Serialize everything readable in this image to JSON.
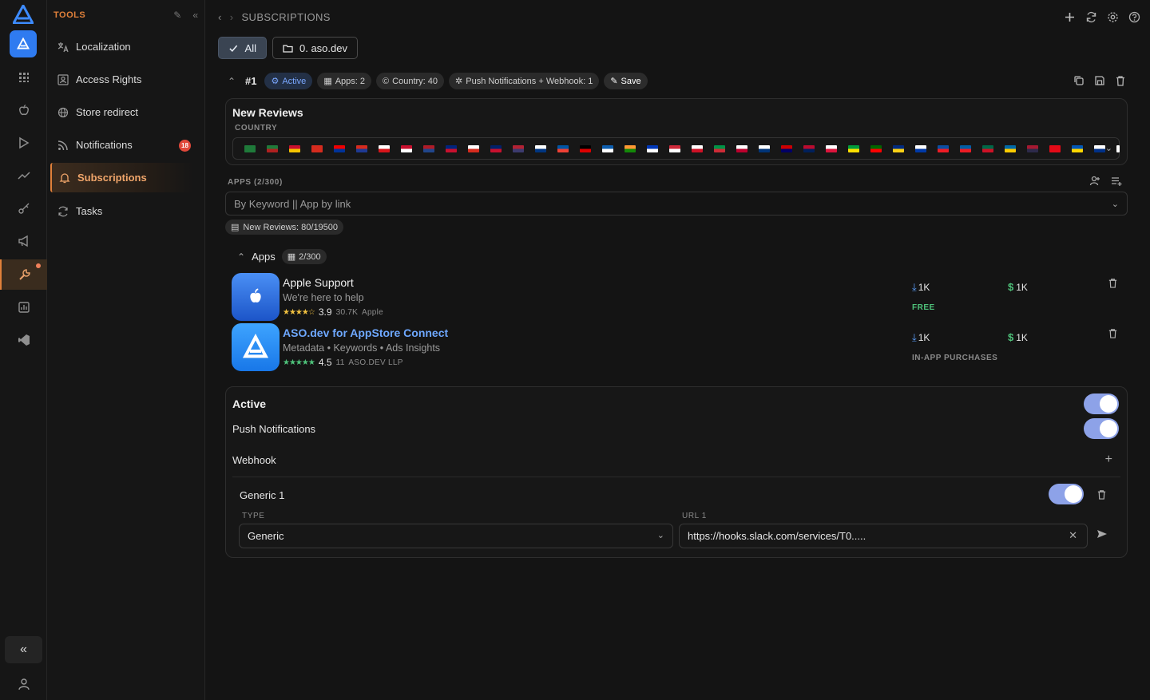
{
  "sidebar": {
    "header": "TOOLS",
    "items": [
      {
        "label": "Localization",
        "icon": "translate-icon"
      },
      {
        "label": "Access Rights",
        "icon": "access-icon"
      },
      {
        "label": "Store redirect",
        "icon": "globe-icon"
      },
      {
        "label": "Notifications",
        "icon": "rss-icon",
        "badge": "18"
      },
      {
        "label": "Subscriptions",
        "icon": "bell-icon",
        "selected": true
      },
      {
        "label": "Tasks",
        "icon": "tasks-icon"
      }
    ]
  },
  "header": {
    "breadcrumb": "SUBSCRIPTIONS"
  },
  "filters": {
    "all_label": "All",
    "project_label": "0. aso.dev"
  },
  "subscription": {
    "number": "#1",
    "chips": {
      "active": "Active",
      "apps": "Apps: 2",
      "country": "Country: 40",
      "channels": "Push Notifications + Webhook: 1",
      "save": "Save"
    }
  },
  "new_reviews": {
    "title": "New Reviews",
    "country_label": "COUNTRY",
    "flags_count": 40
  },
  "apps_section": {
    "label": "APPS (2/300)",
    "search_placeholder": "By Keyword || App by link",
    "quota": "New Reviews: 80/19500",
    "header": "Apps",
    "count": "2/300",
    "items": [
      {
        "name": "Apple Support",
        "subtitle": "We're here to help",
        "stars": "★★★★☆",
        "rating": "3.9",
        "reviews": "30.7K",
        "developer": "Apple",
        "downloads": "1K",
        "revenue": "1K",
        "price": "FREE",
        "price_color": "#4ec27a"
      },
      {
        "name": "ASO.dev for AppStore Connect",
        "subtitle": "Metadata • Keywords • Ads Insights",
        "stars": "★★★★★",
        "rating": "4.5",
        "reviews": "11",
        "developer": "ASO.DEV LLP",
        "downloads": "1K",
        "revenue": "1K",
        "price": "IN-APP PURCHASES",
        "price_color": "#8a8a8a"
      }
    ]
  },
  "settings": {
    "active_label": "Active",
    "push_label": "Push Notifications",
    "webhook_label": "Webhook",
    "webhook": {
      "name": "Generic 1",
      "type_label": "TYPE",
      "type_value": "Generic",
      "url_label": "URL 1",
      "url_value": "https://hooks.slack.com/services/T0....."
    }
  },
  "colors": {
    "accent": "#e0803a",
    "brand": "#2f7bf0",
    "toggle_on": "#8da2e8"
  }
}
